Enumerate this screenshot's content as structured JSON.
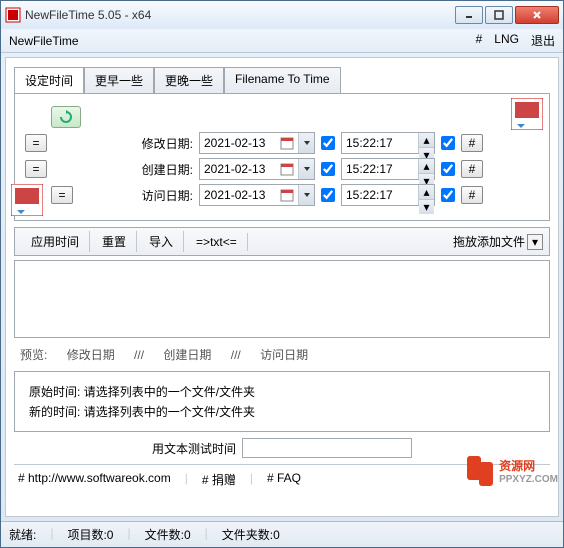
{
  "window": {
    "title": "NewFileTime 5.05 - x64"
  },
  "menubar": {
    "app_name": "NewFileTime",
    "hash": "#",
    "lng": "LNG",
    "exit": "退出"
  },
  "tabs": {
    "set_time": "设定时间",
    "earlier": "更早一些",
    "later": "更晚一些",
    "fn_to_time": "Filename To Time"
  },
  "labels": {
    "modify": "修改日期:",
    "create": "创建日期:",
    "access": "访问日期:"
  },
  "values": {
    "date": "2021-02-13",
    "time": "15:22:17"
  },
  "eq": "=",
  "hash_btn": "#",
  "toolbar": {
    "apply": "应用时间",
    "reset": "重置",
    "import": "导入",
    "txt": "=>txt<=",
    "drag": "拖放添加文件"
  },
  "preview": {
    "title": "预览:",
    "modify": "修改日期",
    "sep": "///",
    "create": "创建日期",
    "access": "访问日期"
  },
  "info": {
    "orig": "原始时间:",
    "new": "新的时间:",
    "hint": "请选择列表中的一个文件/文件夹"
  },
  "text_test": {
    "label": "用文本测试时间",
    "value": ""
  },
  "footer": {
    "url": "# http://www.softwareok.com",
    "donate": "# 捐赠",
    "faq": "# FAQ"
  },
  "status": {
    "ready": "就绪:",
    "items": "项目数:0",
    "files": "文件数:0",
    "folders": "文件夹数:0"
  },
  "watermark": {
    "big": "PP",
    "label": "资源网",
    "url": "PPXYZ.COM"
  }
}
